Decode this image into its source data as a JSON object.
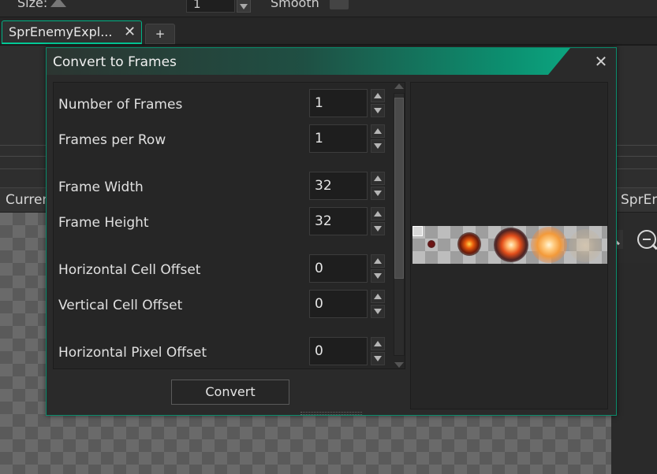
{
  "background": {
    "size_label": "Size:",
    "size_value": "1",
    "smooth_label": "Smooth",
    "left_label": "Curren",
    "right_label": "SprEn"
  },
  "tabs": [
    {
      "label": "SprEnemyExpl...",
      "close": "✕"
    }
  ],
  "tab_add_label": "+",
  "dialog": {
    "title": "Convert to Frames",
    "close_glyph": "✕",
    "fields": [
      {
        "label": "Number of Frames",
        "value": "1"
      },
      {
        "label": "Frames per Row",
        "value": "1"
      },
      {
        "label": "Frame Width",
        "value": "32"
      },
      {
        "label": "Frame Height",
        "value": "32"
      },
      {
        "label": "Horizontal Cell Offset",
        "value": "0"
      },
      {
        "label": "Vertical Cell Offset",
        "value": "0"
      },
      {
        "label": "Horizontal Pixel Offset",
        "value": "0"
      }
    ],
    "convert_label": "Convert"
  },
  "icons": {
    "tab_close": "close-icon",
    "dialog_close": "close-icon",
    "zoom_out": "zoom-out-icon",
    "zoom_in": "zoom-in-icon",
    "spin_up": "triangle-up-icon",
    "spin_down": "triangle-down-icon"
  },
  "colors": {
    "accent": "#0cb38a",
    "panel_bg": "#262626",
    "dialog_bg": "#2a2a2a"
  }
}
